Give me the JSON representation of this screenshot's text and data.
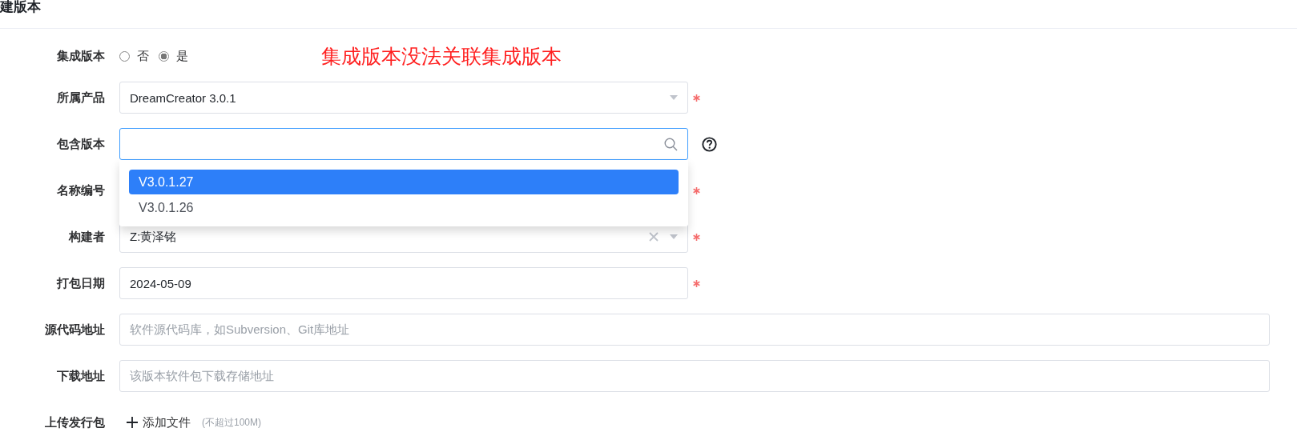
{
  "page_title": "建版本",
  "note": "集成版本没法关联集成版本",
  "fields": [
    {
      "kind": "radio",
      "label": "集成版本",
      "options": [
        {
          "label": "否",
          "selected": false
        },
        {
          "label": "是",
          "selected": true
        }
      ]
    },
    {
      "kind": "select",
      "label": "所属产品",
      "value": "DreamCreator 3.0.1",
      "required": true
    },
    {
      "kind": "search",
      "label": "包含版本",
      "focused": true,
      "help": true,
      "options": [
        {
          "label": "V3.0.1.27",
          "selected": true
        },
        {
          "label": "V3.0.1.26",
          "selected": false
        }
      ]
    },
    {
      "kind": "text",
      "label": "名称编号",
      "required": true
    },
    {
      "kind": "select",
      "label": "构建者",
      "value": "Z:黄泽铭",
      "clearable": true,
      "required": true
    },
    {
      "kind": "text",
      "label": "打包日期",
      "value": "2024-05-09",
      "required": true
    },
    {
      "kind": "text",
      "label": "源代码地址",
      "placeholder": "软件源代码库，如Subversion、Git库地址",
      "wide": true
    },
    {
      "kind": "text",
      "label": "下载地址",
      "placeholder": "该版本软件包下载存储地址",
      "wide": true
    },
    {
      "kind": "upload",
      "label": "上传发行包",
      "button": "添加文件",
      "hint": "(不超过100M)"
    }
  ]
}
